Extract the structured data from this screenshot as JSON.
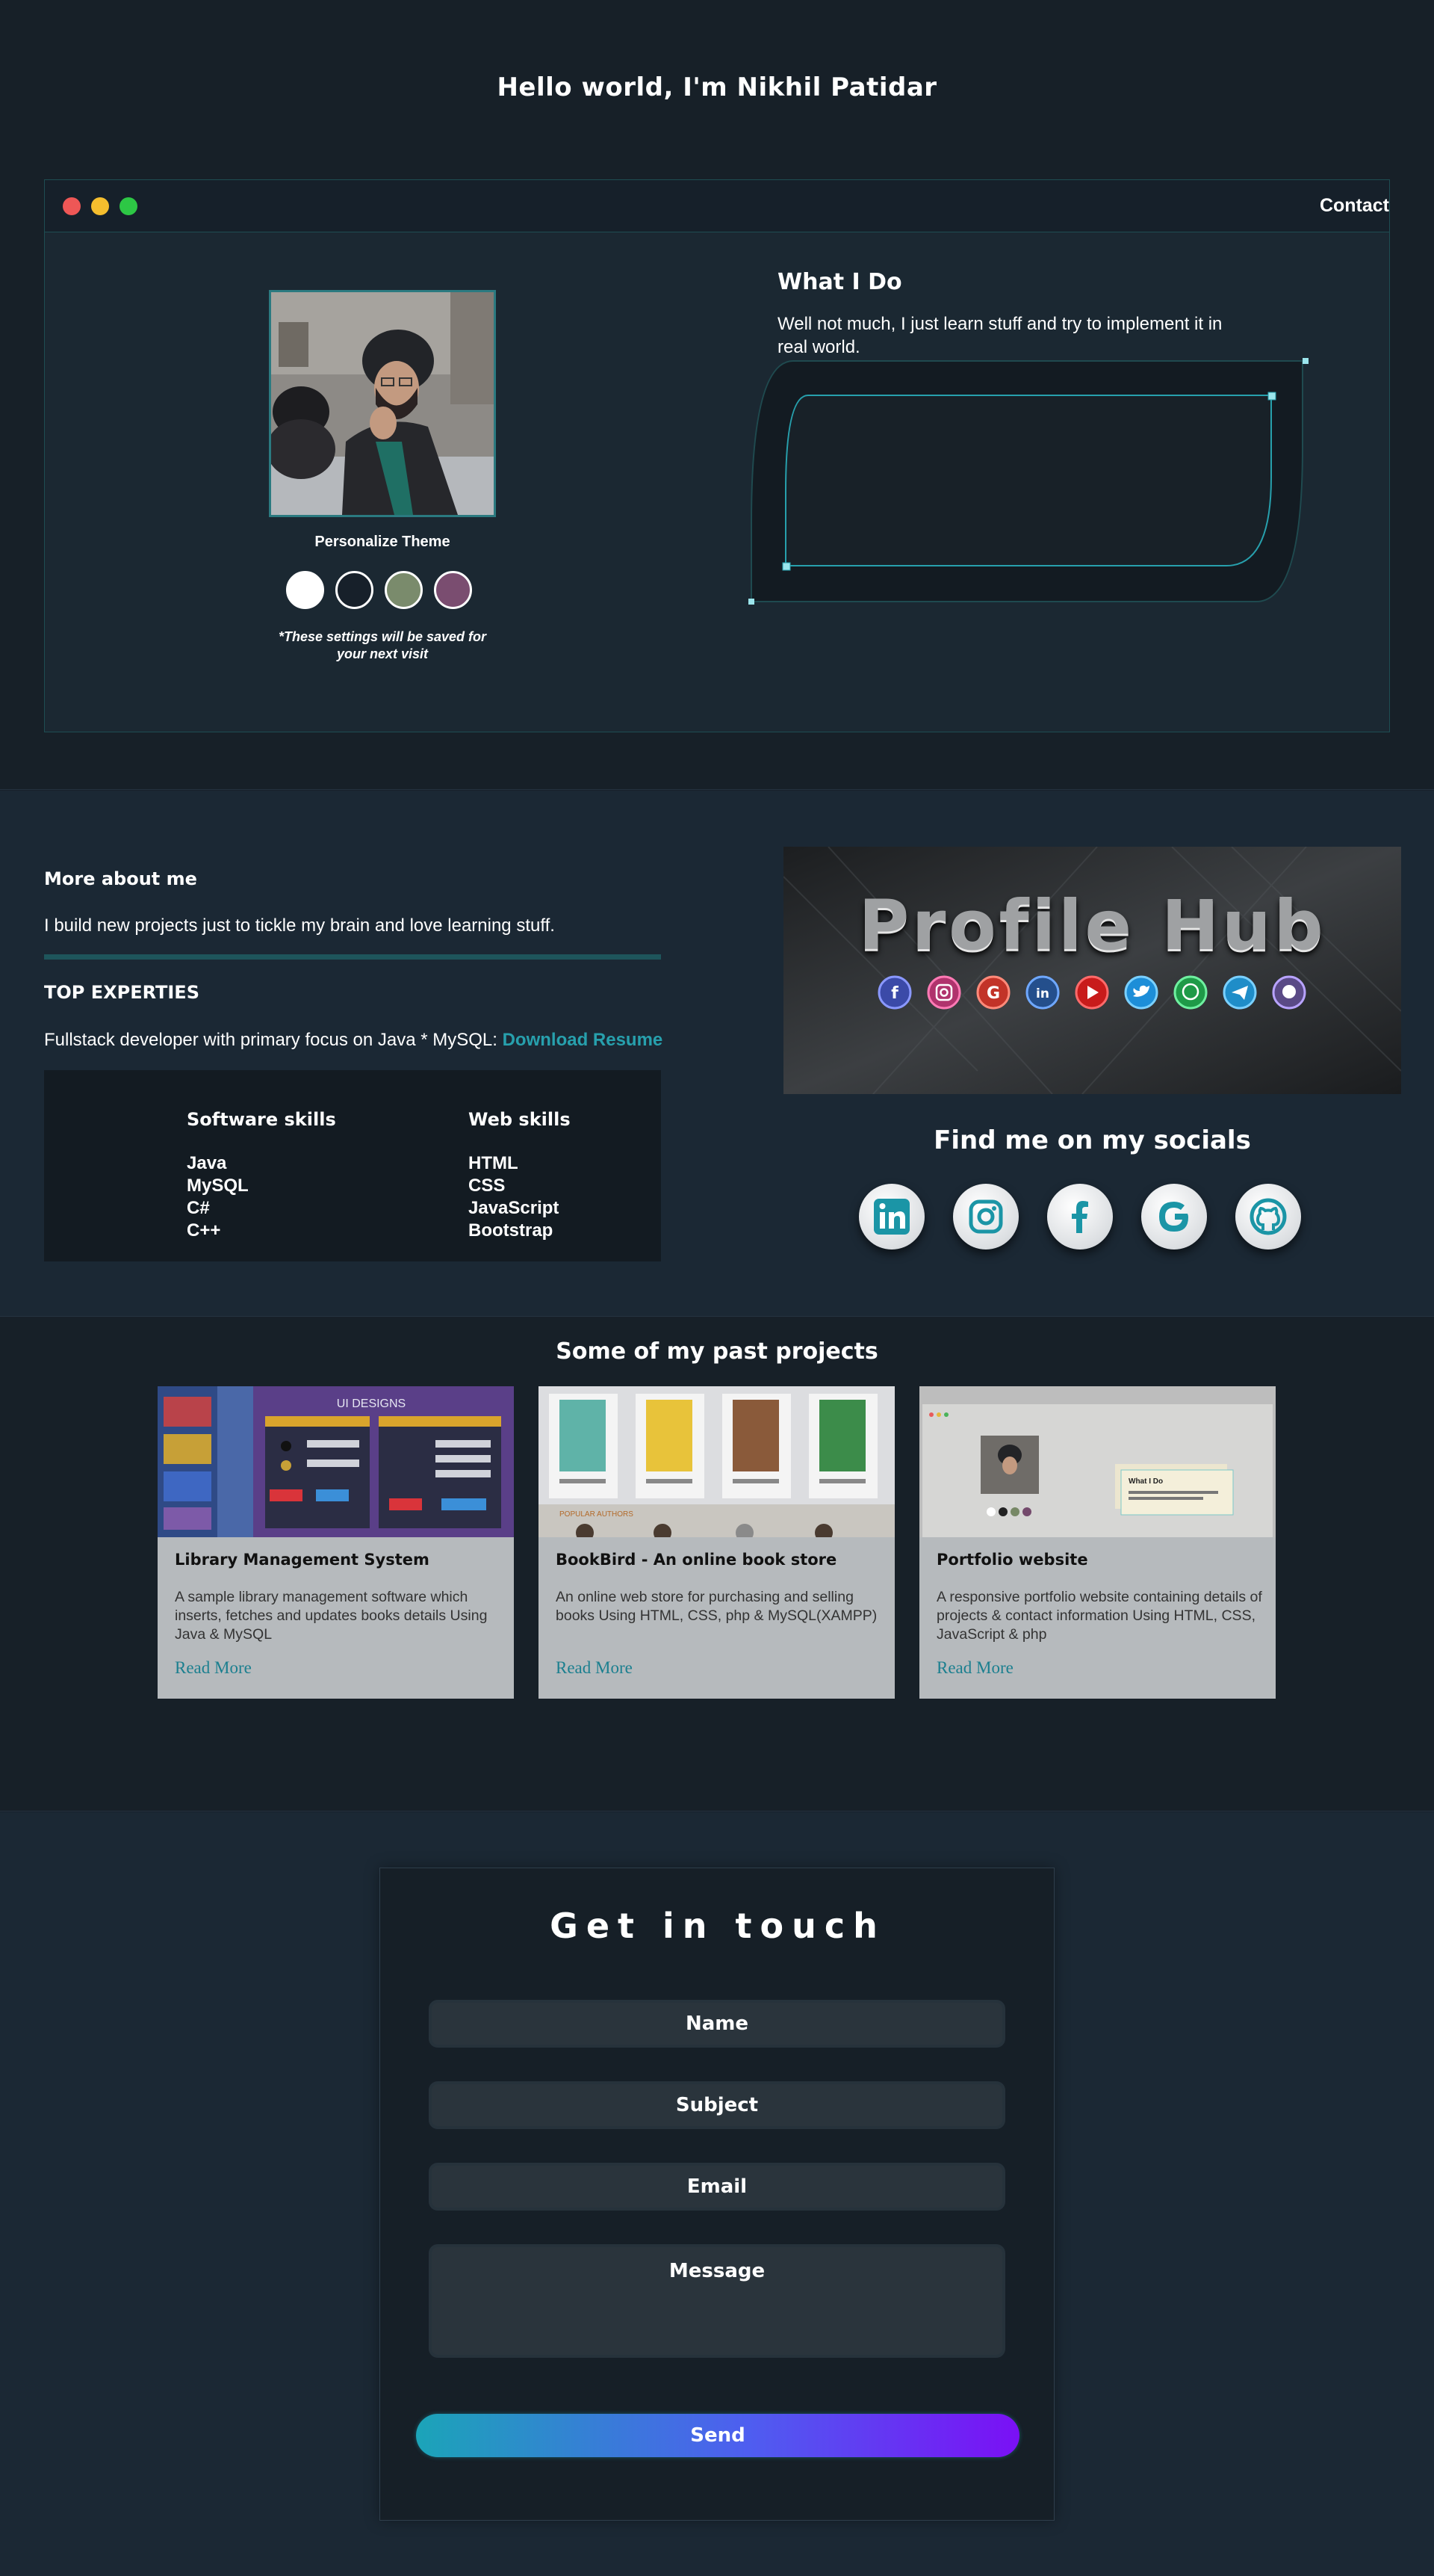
{
  "hero": {
    "title": "Hello world, I'm Nikhil Patidar"
  },
  "nav": {
    "contact": "Contact"
  },
  "theme": {
    "label": "Personalize Theme",
    "note": "*These settings will be saved for your next visit",
    "swatch_colors": [
      "#ffffff",
      "#17202a",
      "#7a8b6c",
      "#7a4d70"
    ]
  },
  "whatido": {
    "title": "What I Do",
    "text": "Well not much, I just learn stuff and try to implement it in real world."
  },
  "about": {
    "heading": "More about me",
    "text": "I build new projects just to tickle my brain and love learning stuff.",
    "expertise_heading": "TOP EXPERTIES",
    "expertise_text": "Fullstack developer with primary focus on Java * MySQL: ",
    "resume_link": "Download Resume"
  },
  "skills": {
    "software": {
      "title": "Software skills",
      "items": [
        "Java",
        "MySQL",
        "C#",
        "C++"
      ]
    },
    "web": {
      "title": "Web skills",
      "items": [
        "HTML",
        "CSS",
        "JavaScript",
        "Bootstrap"
      ]
    }
  },
  "banner": {
    "title": "Profile Hub"
  },
  "socials": {
    "title": "Find me on my socials",
    "icons": [
      "linkedin-icon",
      "instagram-icon",
      "facebook-icon",
      "google-icon",
      "github-icon"
    ]
  },
  "projects": {
    "title": "Some of my past projects",
    "read_more": "Read More",
    "items": [
      {
        "name": "Library Management System",
        "desc": "A sample library management software which inserts, fetches and updates books details Using Java & MySQL",
        "thumb_caption": "UI DESIGNS"
      },
      {
        "name": "BookBird - An online book store",
        "desc": "An online web store for purchasing and selling books Using HTML, CSS, php & MySQL(XAMPP)",
        "thumb_caption": "POPULAR AUTHORS"
      },
      {
        "name": "Portfolio website",
        "desc": "A responsive portfolio website containing details of projects & contact information Using HTML, CSS, JavaScript & php",
        "thumb_caption": "What I Do"
      }
    ]
  },
  "contact_form": {
    "title": "Get in touch",
    "name_placeholder": "Name",
    "subject_placeholder": "Subject",
    "email_placeholder": "Email",
    "message_placeholder": "Message",
    "send_label": "Send"
  },
  "colors": {
    "accent": "#27a0ad",
    "background": "#17202a",
    "send_gradient_end": "#7a10f5"
  }
}
